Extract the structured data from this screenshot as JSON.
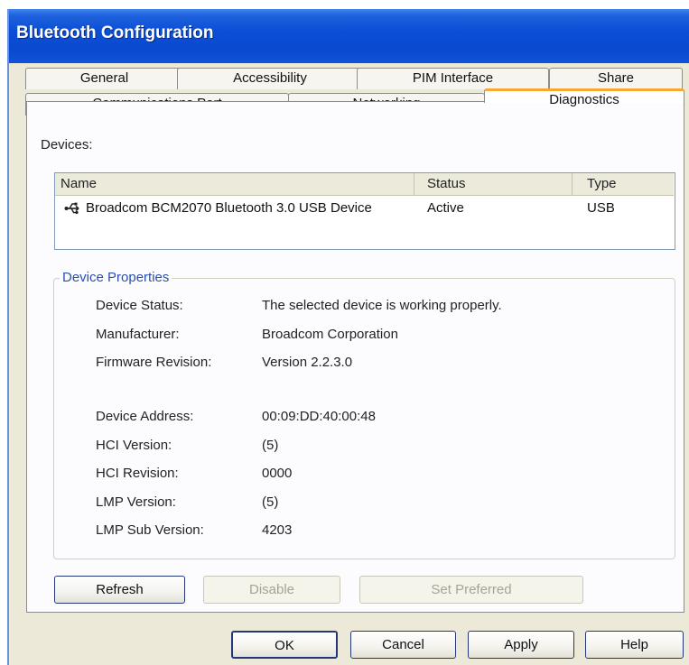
{
  "window": {
    "title": "Bluetooth Configuration"
  },
  "tabs": {
    "row_back": [
      "General",
      "Accessibility",
      "PIM Interface",
      "Share"
    ],
    "row_front": [
      "Communications Port",
      "Networking",
      "Diagnostics"
    ],
    "active": "Diagnostics"
  },
  "devices": {
    "label": "Devices:",
    "columns": [
      "Name",
      "Status",
      "Type"
    ],
    "rows": [
      {
        "icon": "usb-icon",
        "name": "Broadcom BCM2070 Bluetooth 3.0 USB Device",
        "status": "Active",
        "type": "USB"
      }
    ]
  },
  "properties": {
    "legend": "Device Properties",
    "items": [
      {
        "key": "Device Status:",
        "value": "The selected device is working properly."
      },
      {
        "key": "Manufacturer:",
        "value": "Broadcom Corporation"
      },
      {
        "key": "Firmware Revision:",
        "value": "Version 2.2.3.0"
      },
      {
        "key": "Device Address:",
        "value": "00:09:DD:40:00:48"
      },
      {
        "key": "HCI Version:",
        "value": "(5)"
      },
      {
        "key": "HCI Revision:",
        "value": "0000"
      },
      {
        "key": "LMP Version:",
        "value": "(5)"
      },
      {
        "key": "LMP Sub Version:",
        "value": "4203"
      }
    ]
  },
  "panel_buttons": {
    "refresh": "Refresh",
    "disable": "Disable",
    "set_preferred": "Set Preferred"
  },
  "dialog_buttons": {
    "ok": "OK",
    "cancel": "Cancel",
    "apply": "Apply",
    "help": "Help"
  },
  "colors": {
    "titlebar": "#0a49cf",
    "active_tab_accent": "#f5a833",
    "legend": "#2a4fb0",
    "dialog_bg": "#ece9d8"
  }
}
